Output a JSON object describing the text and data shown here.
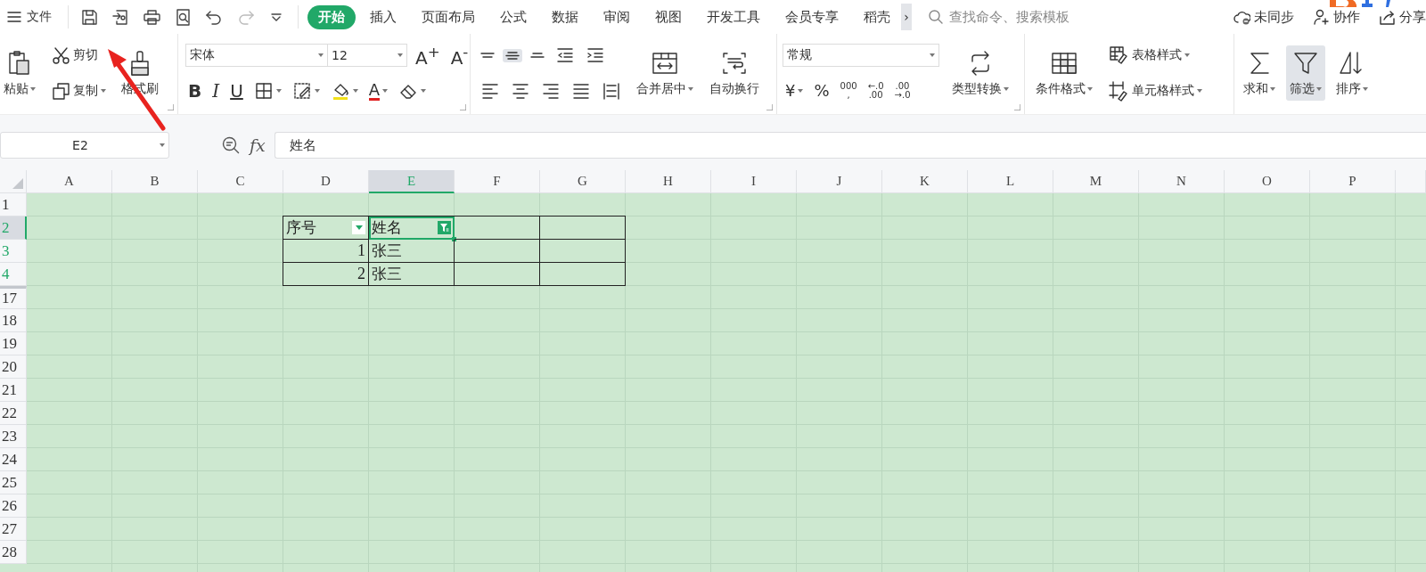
{
  "menu_button": {
    "label": "文件"
  },
  "quick_access": [
    {
      "kind": "save",
      "disabled": false
    },
    {
      "kind": "export",
      "disabled": false
    },
    {
      "kind": "print",
      "disabled": false
    },
    {
      "kind": "preview",
      "disabled": false
    },
    {
      "kind": "undo",
      "disabled": false
    },
    {
      "kind": "redo",
      "disabled": true
    },
    {
      "kind": "customize",
      "disabled": false
    }
  ],
  "tabs": [
    {
      "label": "开始",
      "selected": true
    },
    {
      "label": "插入",
      "selected": false
    },
    {
      "label": "页面布局",
      "selected": false
    },
    {
      "label": "公式",
      "selected": false
    },
    {
      "label": "数据",
      "selected": false
    },
    {
      "label": "审阅",
      "selected": false
    },
    {
      "label": "视图",
      "selected": false
    },
    {
      "label": "开发工具",
      "selected": false
    },
    {
      "label": "会员专享",
      "selected": false
    },
    {
      "label": "稻壳",
      "selected": false
    }
  ],
  "tab_scroll": {
    "glyph": "›"
  },
  "search": {
    "placeholder": "查找命令、搜索模板"
  },
  "account_actions": [
    {
      "kind": "sync",
      "label": "未同步"
    },
    {
      "kind": "collaborate",
      "label": "协作"
    },
    {
      "kind": "share",
      "label": "分享"
    }
  ],
  "ribbon": {
    "groups": [
      {
        "launcher": true,
        "columns": [
          {
            "rows": [
              [
                {
                  "kind": "paste",
                  "label": "粘贴",
                  "dropdown": true,
                  "selected": false
                }
              ]
            ]
          },
          {
            "rows": [
              [
                {
                  "kind": "cut",
                  "label": "剪切",
                  "dropdown": false,
                  "selected": false
                }
              ],
              [
                {
                  "kind": "copy",
                  "label": "复制",
                  "dropdown": true,
                  "selected": false
                }
              ]
            ]
          },
          {
            "rows": [
              [
                {
                  "kind": "format-painter",
                  "label": "格式刷",
                  "dropdown": false,
                  "selected": false
                }
              ]
            ]
          }
        ]
      },
      {
        "launcher": true,
        "columns": [
          {
            "rows": [
              [
                {
                  "kind": "font-select",
                  "value": "宋体"
                },
                {
                  "kind": "size-select",
                  "value": "12"
                },
                {
                  "kind": "grow-font",
                  "glyph": "A$^{+}$",
                  "dropdown": false,
                  "selected": false
                },
                {
                  "kind": "shrink-font",
                  "glyph": "A$^{-}$",
                  "dropdown": false,
                  "selected": false
                }
              ],
              [
                {
                  "kind": "bold",
                  "glyph": "B",
                  "dropdown": false,
                  "selected": false
                },
                {
                  "kind": "italic",
                  "glyph": "I",
                  "dropdown": false,
                  "selected": false
                },
                {
                  "kind": "underline",
                  "glyph": "U",
                  "dropdown": false,
                  "selected": false
                },
                {
                  "kind": "borders",
                  "dropdown": true,
                  "selected": false
                },
                {
                  "kind": "fill-pattern",
                  "dropdown": true,
                  "selected": false
                },
                {
                  "kind": "highlight",
                  "dropdown": true,
                  "selected": false
                },
                {
                  "kind": "font-color",
                  "glyph": "A",
                  "dropdown": true,
                  "selected": false
                },
                {
                  "kind": "clear",
                  "dropdown": true,
                  "selected": false
                }
              ]
            ]
          }
        ]
      },
      {
        "launcher": true,
        "columns": [
          {
            "rows": [
              [
                {
                  "kind": "align-top",
                  "dropdown": false,
                  "selected": false
                },
                {
                  "kind": "align-middle",
                  "dropdown": false,
                  "selected": true
                },
                {
                  "kind": "align-bottom",
                  "dropdown": false,
                  "selected": false
                },
                {
                  "kind": "outdent",
                  "dropdown": false,
                  "selected": false
                },
                {
                  "kind": "indent",
                  "dropdown": false,
                  "selected": false
                }
              ],
              [
                {
                  "kind": "align-left",
                  "dropdown": false,
                  "selected": false
                },
                {
                  "kind": "align-center",
                  "dropdown": false,
                  "selected": false
                },
                {
                  "kind": "align-right",
                  "dropdown": false,
                  "selected": false
                },
                {
                  "kind": "justify",
                  "dropdown": false,
                  "selected": false
                },
                {
                  "kind": "distribute",
                  "dropdown": false,
                  "selected": false
                }
              ]
            ]
          },
          {
            "rows": [
              [
                {
                  "kind": "merge",
                  "label": "合并居中",
                  "dropdown": true,
                  "selected": false
                }
              ]
            ]
          },
          {
            "rows": [
              [
                {
                  "kind": "wrap",
                  "label": "自动换行",
                  "dropdown": false,
                  "selected": false
                }
              ]
            ]
          }
        ]
      },
      {
        "launcher": true,
        "columns": [
          {
            "rows": [
              [
                {
                  "kind": "format-select",
                  "value": "常规"
                }
              ],
              [
                {
                  "kind": "currency",
                  "glyph": "¥",
                  "dropdown": true,
                  "selected": false
                },
                {
                  "kind": "percent",
                  "glyph": "%",
                  "dropdown": false,
                  "selected": false
                },
                {
                  "kind": "thousands",
                  "glyph": "000\n,",
                  "dropdown": false,
                  "selected": false
                },
                {
                  "kind": "decimal-more",
                  "glyph": "←.0\n.00",
                  "dropdown": false,
                  "selected": false
                },
                {
                  "kind": "decimal-less",
                  "glyph": ".00\n→.0",
                  "dropdown": false,
                  "selected": false
                }
              ]
            ]
          },
          {
            "rows": [
              [
                {
                  "kind": "convert",
                  "label": "类型转换",
                  "dropdown": true,
                  "selected": false
                }
              ]
            ]
          }
        ]
      },
      {
        "launcher": false,
        "columns": [
          {
            "rows": [
              [
                {
                  "kind": "conditional-format",
                  "label": "条件格式",
                  "dropdown": true,
                  "selected": false
                }
              ]
            ]
          },
          {
            "rows": [
              [
                {
                  "kind": "table-style",
                  "label": "表格样式",
                  "dropdown": true,
                  "selected": false
                }
              ],
              [
                {
                  "kind": "cell-style",
                  "label": "单元格样式",
                  "dropdown": true,
                  "selected": false
                }
              ]
            ]
          }
        ]
      },
      {
        "launcher": false,
        "columns": [
          {
            "rows": [
              [
                {
                  "kind": "sum",
                  "label": "求和",
                  "dropdown": true,
                  "selected": false
                }
              ]
            ]
          },
          {
            "rows": [
              [
                {
                  "kind": "filter",
                  "label": "筛选",
                  "dropdown": true,
                  "selected": true
                }
              ]
            ]
          },
          {
            "rows": [
              [
                {
                  "kind": "sort",
                  "label": "排序",
                  "dropdown": true,
                  "selected": false
                }
              ]
            ]
          }
        ]
      }
    ]
  },
  "name_box": {
    "value": "E2"
  },
  "formula_bar": {
    "label": "fx",
    "value": "姓名"
  },
  "sheet": {
    "columns": [
      {
        "label": "A",
        "selected": false
      },
      {
        "label": "B",
        "selected": false
      },
      {
        "label": "C",
        "selected": false
      },
      {
        "label": "D",
        "selected": false
      },
      {
        "label": "E",
        "selected": true
      },
      {
        "label": "F",
        "selected": false
      },
      {
        "label": "G",
        "selected": false
      },
      {
        "label": "H",
        "selected": false
      },
      {
        "label": "I",
        "selected": false
      },
      {
        "label": "J",
        "selected": false
      },
      {
        "label": "K",
        "selected": false
      },
      {
        "label": "L",
        "selected": false
      },
      {
        "label": "M",
        "selected": false
      },
      {
        "label": "N",
        "selected": false
      },
      {
        "label": "O",
        "selected": false
      },
      {
        "label": "P",
        "selected": false
      }
    ],
    "rows": [
      {
        "label": "1",
        "selected": false,
        "filtered": false,
        "hidden_above": false
      },
      {
        "label": "2",
        "selected": true,
        "filtered": true,
        "hidden_above": false
      },
      {
        "label": "3",
        "selected": false,
        "filtered": true,
        "hidden_above": false
      },
      {
        "label": "4",
        "selected": false,
        "filtered": true,
        "hidden_above": false
      },
      {
        "label": "17",
        "selected": false,
        "filtered": false,
        "hidden_above": true
      },
      {
        "label": "18",
        "selected": false,
        "filtered": false,
        "hidden_above": false
      },
      {
        "label": "19",
        "selected": false,
        "filtered": false,
        "hidden_above": false
      },
      {
        "label": "20",
        "selected": false,
        "filtered": false,
        "hidden_above": false
      },
      {
        "label": "21",
        "selected": false,
        "filtered": false,
        "hidden_above": false
      },
      {
        "label": "22",
        "selected": false,
        "filtered": false,
        "hidden_above": false
      },
      {
        "label": "23",
        "selected": false,
        "filtered": false,
        "hidden_above": false
      },
      {
        "label": "24",
        "selected": false,
        "filtered": false,
        "hidden_above": false
      },
      {
        "label": "25",
        "selected": false,
        "filtered": false,
        "hidden_above": false
      },
      {
        "label": "26",
        "selected": false,
        "filtered": false,
        "hidden_above": false
      },
      {
        "label": "27",
        "selected": false,
        "filtered": false,
        "hidden_above": false
      },
      {
        "label": "28",
        "selected": false,
        "filtered": false,
        "hidden_above": false
      }
    ],
    "table": {
      "rows": [
        [
          {
            "kind": "header",
            "value": "序号",
            "filtered": false,
            "selected": false
          },
          {
            "kind": "header",
            "value": "姓名",
            "filtered": true,
            "selected": true
          },
          {
            "kind": "blank",
            "selected": false
          },
          {
            "kind": "blank",
            "selected": false
          }
        ],
        [
          {
            "kind": "number",
            "value": "1",
            "selected": false
          },
          {
            "kind": "text",
            "value": "张三",
            "selected": false
          },
          {
            "kind": "blank",
            "selected": false
          },
          {
            "kind": "blank",
            "selected": false
          }
        ],
        [
          {
            "kind": "number",
            "value": "2",
            "selected": false
          },
          {
            "kind": "text",
            "value": "张三",
            "selected": false
          },
          {
            "kind": "blank",
            "selected": false
          },
          {
            "kind": "blank",
            "selected": false
          }
        ]
      ]
    }
  }
}
